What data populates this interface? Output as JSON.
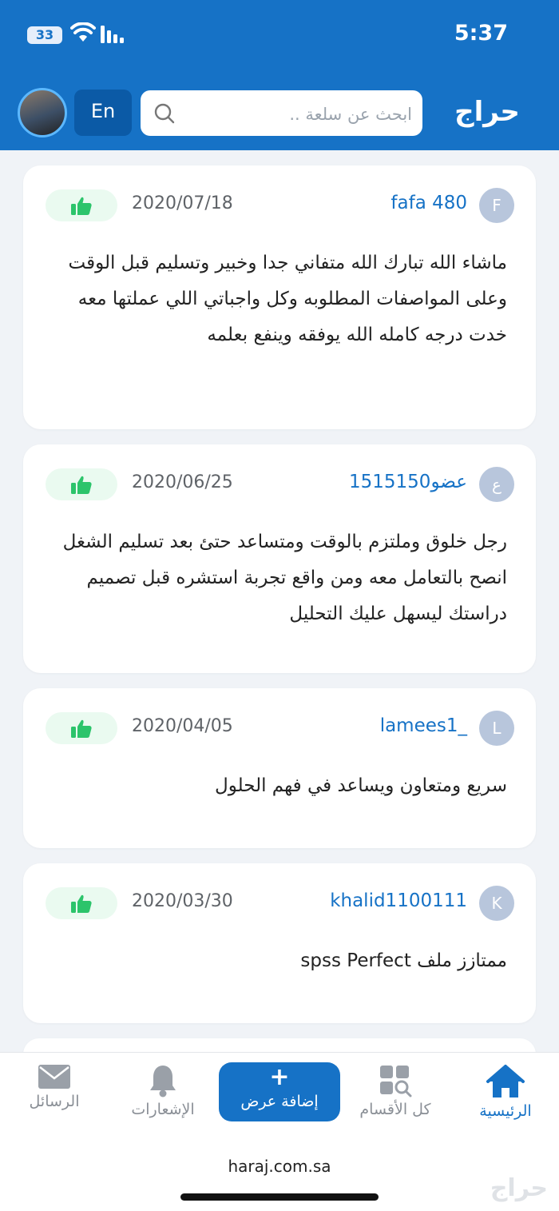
{
  "status_bar": {
    "time": "5:37",
    "battery": "33"
  },
  "header": {
    "logo": "حراج",
    "language_button": "En",
    "search_placeholder": "ابحث عن سلعة .."
  },
  "reviews": [
    {
      "avatar_letter": "F",
      "username": "fafa 480",
      "date": "2020/07/18",
      "text": "ماشاء الله تبارك الله متفاني جدا وخبير وتسليم قبل الوقت وعلى المواصفات المطلوبه وكل واجباتي اللي عملتها معه خدت درجه كامله الله يوفقه وينفع بعلمه"
    },
    {
      "avatar_letter": "ع",
      "username": "عضو1515150",
      "date": "2020/06/25",
      "text": "رجل خلوق وملتزم بالوقت ومتساعد حتئ بعد تسليم الشغل   انصح بالتعامل معه ومن واقع تجربة استشره قبل تصميم دراستك ليسهل عليك التحليل"
    },
    {
      "avatar_letter": "L",
      "username": "lamees1_",
      "date": "2020/04/05",
      "text": "سريع ومتعاون ويساعد في فهم الحلول"
    },
    {
      "avatar_letter": "K",
      "username": "khalid1100111",
      "date": "2020/03/30",
      "text": "ممتازز ملف spss   Perfect"
    }
  ],
  "bottom_nav": {
    "home": "الرئيسية",
    "categories": "كل الأقسام",
    "add_offer": "إضافة عرض",
    "add_plus": "+",
    "notifications": "الإشعارات",
    "messages": "الرسائل"
  },
  "footer": {
    "url": "haraj.com.sa",
    "watermark": "حراج"
  },
  "colors": {
    "brand_blue": "#1672c6",
    "like_green": "#2cc46b",
    "background": "#f0f3f7"
  }
}
